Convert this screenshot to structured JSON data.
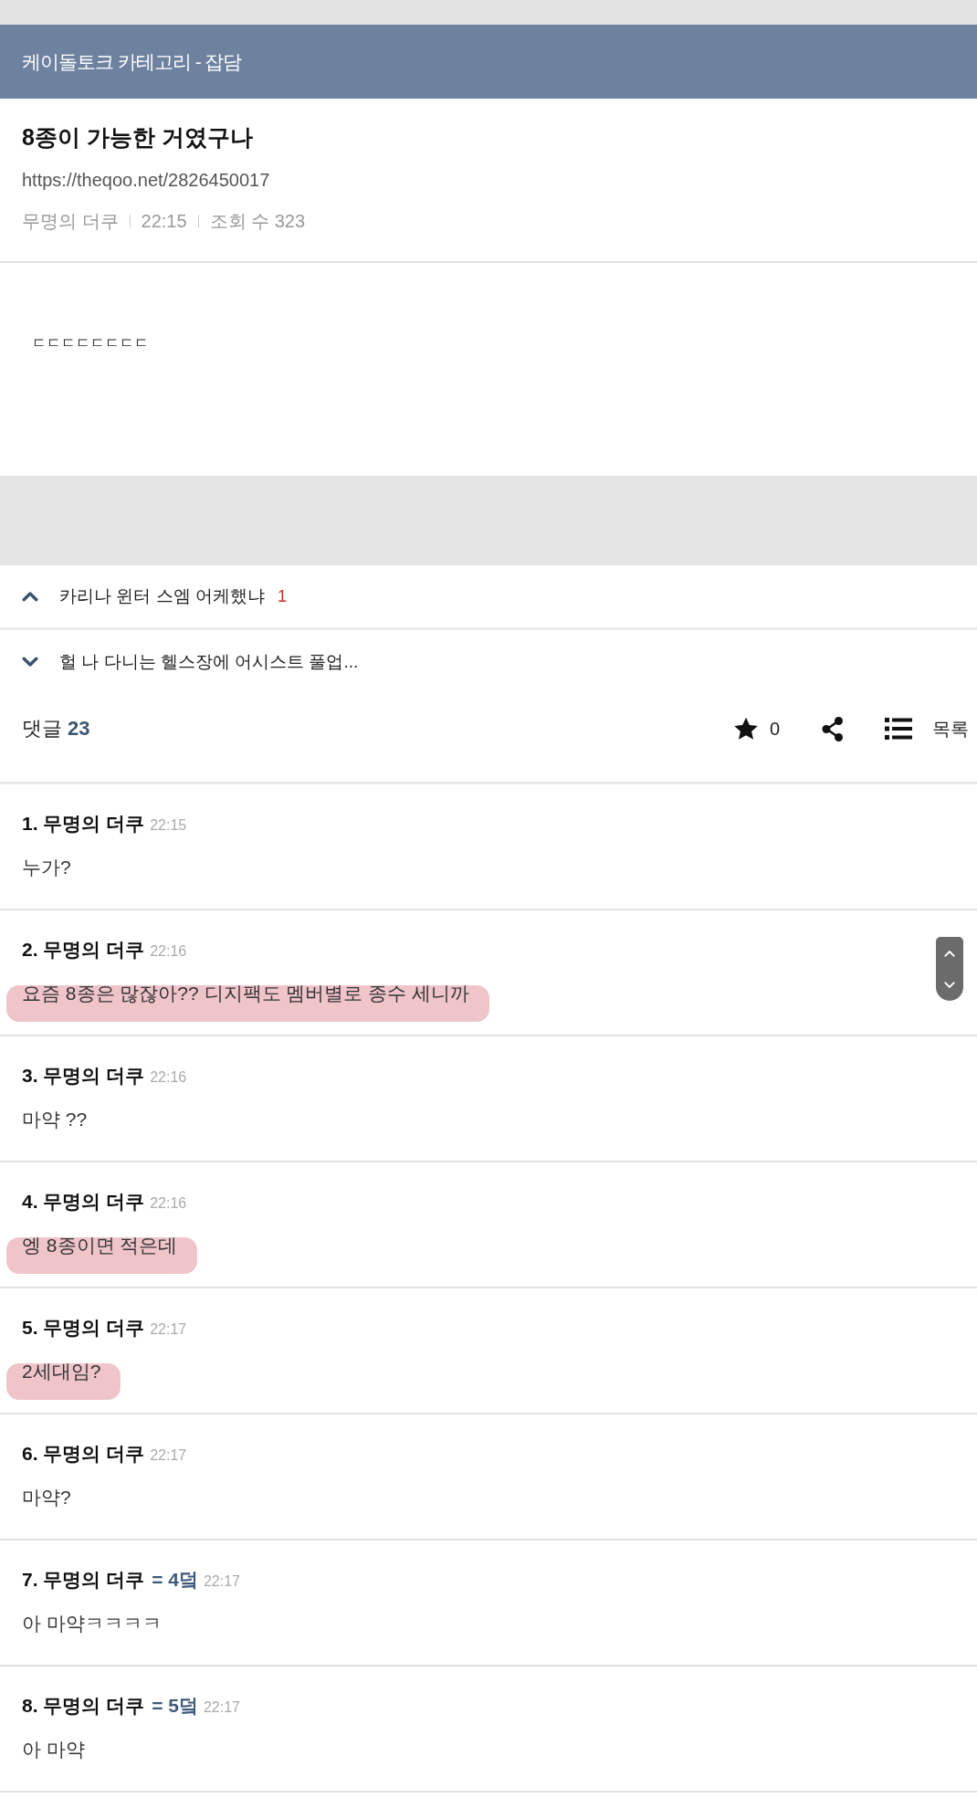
{
  "category": "케이돌토크 카테고리 - 잡담",
  "post": {
    "title": "8종이 가능한 거였구나",
    "url": "https://theqoo.net/2826450017",
    "author": "무명의 더쿠",
    "time": "22:15",
    "views": "조회 수 323",
    "body": "ㄷㄷㄷㄷㄷㄷㄷㄷ"
  },
  "post_nav": [
    {
      "kind": "prev",
      "title": "카리나 윈터 스엠 어케했냐",
      "comment_count": "1"
    },
    {
      "kind": "next",
      "title": "헐 나 다니는 헬스장에 어시스트 풀업..."
    }
  ],
  "comment_bar": {
    "label": "댓글",
    "count": "23",
    "recommend_count": "0",
    "list_label": "목록"
  },
  "comments": [
    {
      "author": "1. 무명의 더쿠",
      "time": "22:15",
      "text": "누가?",
      "highlighted": false
    },
    {
      "author": "2. 무명의 더쿠",
      "time": "22:16",
      "text": "요즘 8종은 많잖아?? 디지팩도 멤버별로 종수 세니까",
      "highlighted": true
    },
    {
      "author": "3. 무명의 더쿠",
      "time": "22:16",
      "text": "마약 ??",
      "highlighted": false
    },
    {
      "author": "4. 무명의 더쿠",
      "time": "22:16",
      "text": "엥 8종이면 적은데",
      "highlighted": true
    },
    {
      "author": "5. 무명의 더쿠",
      "time": "22:17",
      "text": "2세대임?",
      "highlighted": true
    },
    {
      "author": "6. 무명의 더쿠",
      "time": "22:17",
      "text": "마약?",
      "highlighted": false
    },
    {
      "author": "7. 무명의 더쿠",
      "reply_to": "= 4덬",
      "time": "22:17",
      "text": "아 마약ㅋㅋㅋㅋ",
      "highlighted": false
    },
    {
      "author": "8. 무명의 더쿠",
      "reply_to": "= 5덬",
      "time": "22:17",
      "text": "아 마약",
      "highlighted": false
    }
  ]
}
